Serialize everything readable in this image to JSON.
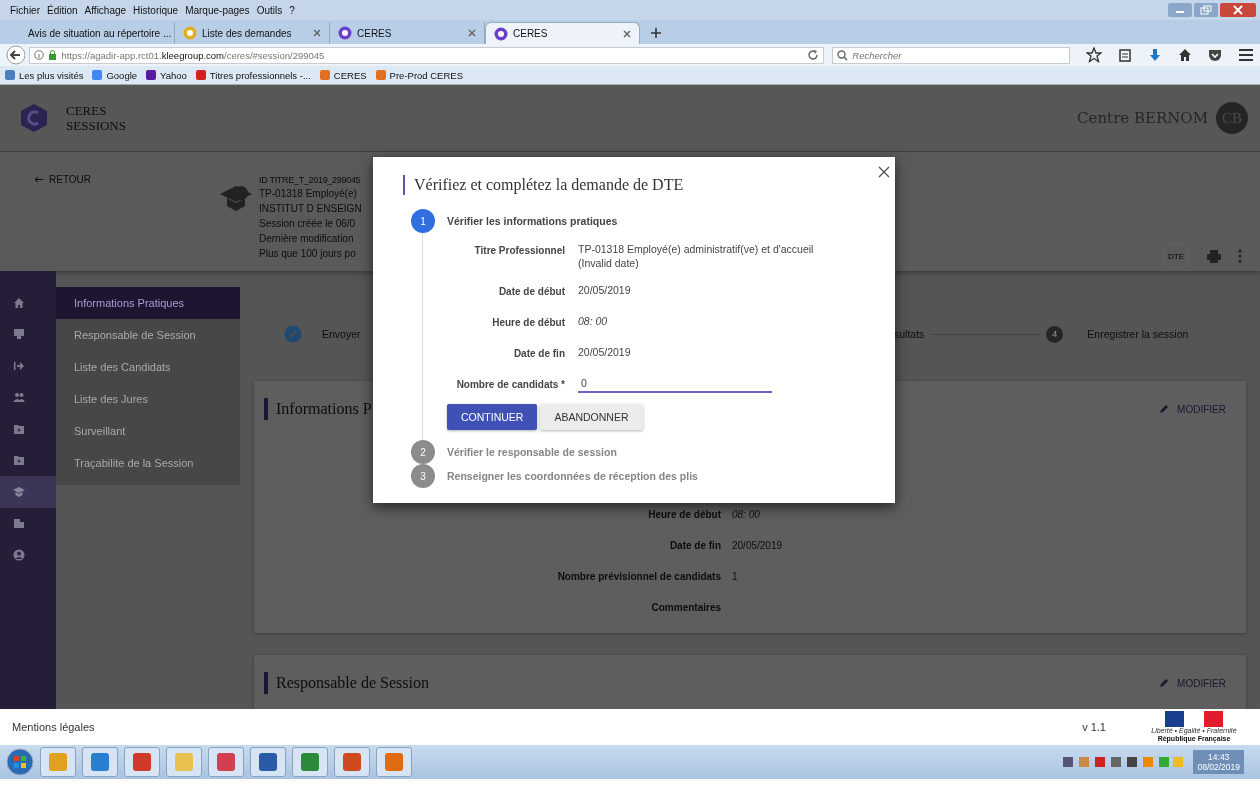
{
  "browser": {
    "menu": [
      "Fichier",
      "Édition",
      "Affichage",
      "Historique",
      "Marque-pages",
      "Outils",
      "?"
    ],
    "tabs": [
      {
        "label": "Avis de situation au répertoire ...",
        "kind": "none",
        "selected": false
      },
      {
        "label": "Liste des demandes",
        "kind": "hazard",
        "selected": false
      },
      {
        "label": "CERES",
        "kind": "ceres",
        "selected": false
      },
      {
        "label": "CERES",
        "kind": "ceres",
        "selected": true
      }
    ],
    "url": {
      "start": "https://agadir-app.rct01.",
      "domain": "kleegroup.com",
      "end": "/ceres/#session/299045"
    },
    "search": {
      "placeholder": "Rechercher"
    },
    "bookmarks": [
      {
        "label": "Les plus visités",
        "kind": "page"
      },
      {
        "label": "Google",
        "kind": "google"
      },
      {
        "label": "Yahoo",
        "kind": "yahoo"
      },
      {
        "label": "Titres professionnels -...",
        "kind": "flag"
      },
      {
        "label": "CERES",
        "kind": "ceres"
      },
      {
        "label": "Pre-Prod CERES",
        "kind": "ceres"
      }
    ]
  },
  "app": {
    "logo_lines": [
      "CERES",
      "SESSIONS"
    ],
    "centre": "Centre BERNOM",
    "avatar": "CB",
    "back": "RETOUR",
    "session_id": "ID TITRE_T_2019_299045",
    "session_lines": [
      "TP-01318 Employé(e)",
      "INSTITUT D ENSEIGN",
      "Session créée le 06/0",
      "Dernière modification",
      "Plus que 100 jours po"
    ],
    "dte_badge": "DTE",
    "rail": [
      {
        "kind": "home",
        "selected": false
      },
      {
        "kind": "monitor",
        "selected": false
      },
      {
        "kind": "arrow",
        "selected": false
      },
      {
        "kind": "people",
        "selected": false
      },
      {
        "kind": "folder-person",
        "selected": false
      },
      {
        "kind": "folder-star",
        "selected": false
      },
      {
        "kind": "cap",
        "selected": true
      },
      {
        "kind": "building",
        "selected": false
      },
      {
        "kind": "user",
        "selected": false
      }
    ],
    "nav": [
      {
        "label": "Informations Pratiques",
        "selected": true
      },
      {
        "label": "Responsable de Session",
        "selected": false
      },
      {
        "label": "Liste des Candidats",
        "selected": false
      },
      {
        "label": "Liste des Jures",
        "selected": false
      },
      {
        "label": "Surveillant",
        "selected": false
      },
      {
        "label": "Traçabilite de la Session",
        "selected": false
      }
    ],
    "stepper": {
      "first_label": "Envoyer",
      "partial_label": "sultats",
      "last_number": "4",
      "last_label": "Enregistrer la session"
    },
    "cards": [
      {
        "title": "Informations P",
        "action": "MODIFIER",
        "rows": [
          {
            "label": "Heure de début",
            "value": "08: 00",
            "kind": "time"
          },
          {
            "label": "Date de fin",
            "value": "20/05/2019",
            "kind": "text"
          },
          {
            "label": "Nombre prévisionnel de candidats",
            "value": "1",
            "kind": "text"
          },
          {
            "label": "Commentaires"
          }
        ]
      },
      {
        "title": "Responsable de Session",
        "action": "MODIFIER"
      }
    ]
  },
  "modal": {
    "title": "Vérifiez et complétez la demande de DTE",
    "steps": [
      {
        "number": "1",
        "label": "Vérifier les informations pratiques",
        "active": true
      },
      {
        "number": "2",
        "label": "Vérifier le responsable de session",
        "active": false
      },
      {
        "number": "3",
        "label": "Renseigner les coordonnées de réception des plis",
        "active": false
      }
    ],
    "fields": [
      {
        "label": "Titre Professionnel",
        "lines": [
          "TP-01318 Employé(e) administratif(ve) et d'accueil",
          "(Invalid date)"
        ],
        "kind": "text"
      },
      {
        "label": "Date de début",
        "lines": [
          "20/05/2019"
        ],
        "kind": "text"
      },
      {
        "label": "Heure de début",
        "lines": [
          "08: 00"
        ],
        "kind": "time"
      },
      {
        "label": "Date de fin",
        "lines": [
          "20/05/2019"
        ],
        "kind": "text"
      },
      {
        "label": "Nombre de candidats *",
        "lines": [
          "0"
        ],
        "kind": "input"
      }
    ],
    "buttons": [
      {
        "label": "CONTINUER",
        "primary": true
      },
      {
        "label": "ABANDONNER",
        "primary": false
      }
    ]
  },
  "footer": {
    "legal": "Mentions légales",
    "version": "v 1.1",
    "emblem_lines": [
      "Liberté • Égalité • Fraternité",
      "République Française"
    ]
  },
  "taskbar": {
    "apps": [
      {
        "kind": "outlook"
      },
      {
        "kind": "ie"
      },
      {
        "kind": "chrome"
      },
      {
        "kind": "folder"
      },
      {
        "kind": "snip"
      },
      {
        "kind": "word"
      },
      {
        "kind": "excel"
      },
      {
        "kind": "ppt"
      },
      {
        "kind": "firefox"
      }
    ],
    "time": "14:43",
    "date": "08/02/2019"
  }
}
